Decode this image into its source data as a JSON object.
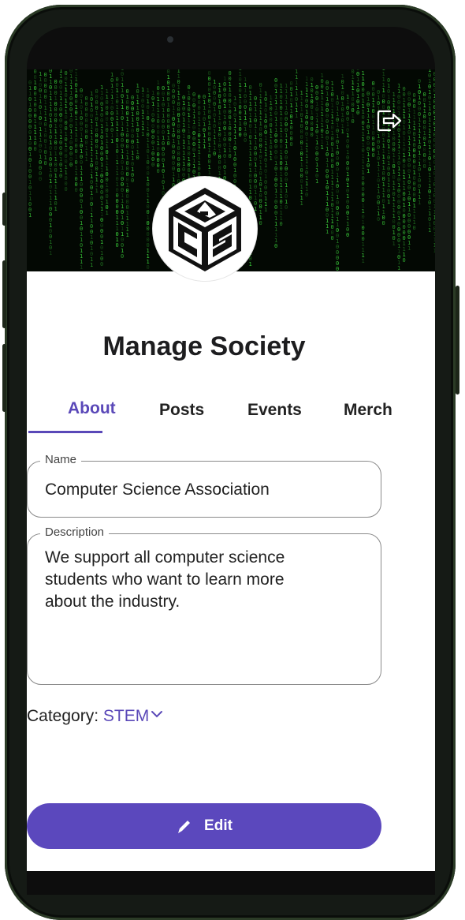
{
  "header": {
    "logout_icon": "logout-icon",
    "logo_icon": "acs-logo"
  },
  "page": {
    "title": "Manage Society"
  },
  "tabs": [
    {
      "label": "About",
      "active": true
    },
    {
      "label": "Posts",
      "active": false
    },
    {
      "label": "Events",
      "active": false
    },
    {
      "label": "Merch",
      "active": false
    }
  ],
  "form": {
    "name": {
      "label": "Name",
      "value": "Computer Science Association"
    },
    "description": {
      "label": "Description",
      "lines": [
        "We support all computer science",
        "students who want to learn more",
        "about the industry."
      ]
    },
    "category": {
      "label": "Category:",
      "value": "STEM",
      "icon": "chevron-down-icon"
    }
  },
  "actions": {
    "edit_label": "Edit",
    "edit_icon": "pencil-icon"
  },
  "colors": {
    "accent": "#5a48b8",
    "matrix_green": "#3cd43c"
  }
}
